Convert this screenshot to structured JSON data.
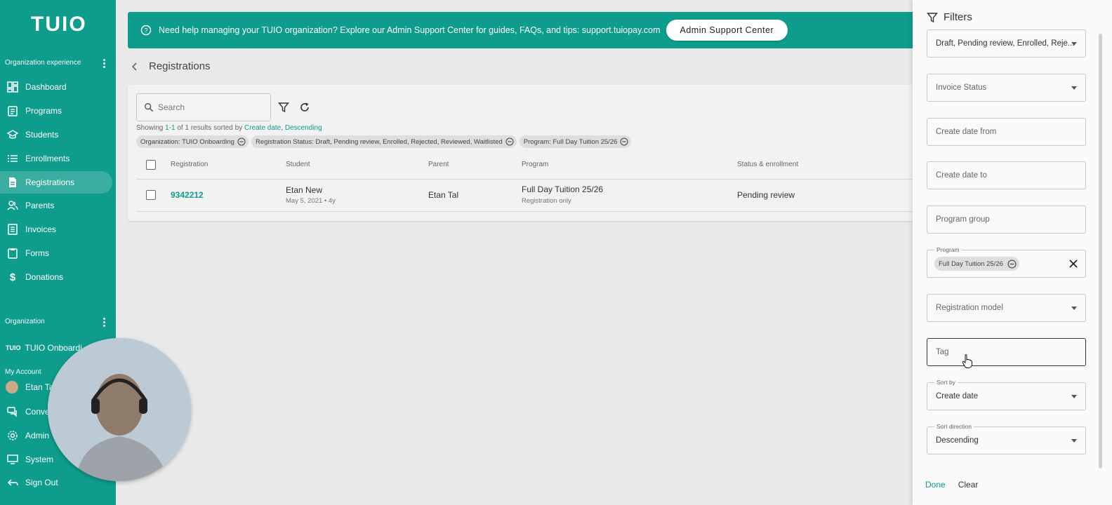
{
  "sidebar": {
    "logo": "TUIO",
    "section_org_experience": "Organization experience",
    "items": [
      {
        "label": "Dashboard"
      },
      {
        "label": "Programs"
      },
      {
        "label": "Students"
      },
      {
        "label": "Enrollments"
      },
      {
        "label": "Registrations"
      },
      {
        "label": "Parents"
      },
      {
        "label": "Invoices"
      },
      {
        "label": "Forms"
      },
      {
        "label": "Donations"
      }
    ],
    "section_organization": "Organization",
    "org_logo": "TUIO",
    "org_name": "TUIO Onboardi",
    "section_my_account": "My Account",
    "account_items": [
      {
        "label": "Etan Ta"
      },
      {
        "label": "Conve"
      },
      {
        "label": "Admin"
      },
      {
        "label": "System"
      },
      {
        "label": "Sign Out"
      }
    ]
  },
  "banner": {
    "text": "Need help managing your TUIO organization? Explore our Admin Support Center for guides, FAQs, and tips: support.tuiopay.com",
    "button": "Admin Support Center"
  },
  "page": {
    "title": "Registrations"
  },
  "toolbar": {
    "search_placeholder": "Search",
    "showing_prefix": "Showing",
    "showing_range": "1-1",
    "showing_mid": "of 1 results sorted by",
    "sort_field": "Create date",
    "sort_sep": ",",
    "sort_dir": "Descending"
  },
  "active_filters": [
    "Organization: TUIO Onboarding",
    "Registration Status: Draft, Pending review, Enrolled, Rejected, Reviewed, Waitlisted",
    "Program: Full Day Tuition 25/26"
  ],
  "table": {
    "columns": [
      "Registration",
      "Student",
      "Parent",
      "Program",
      "Status & enrollment"
    ],
    "rows": [
      {
        "registration": "9342212",
        "student": "Etan New",
        "student_sub": "May 5, 2021 • 4y",
        "parent": "Etan Tal",
        "program": "Full Day Tuition 25/26",
        "program_sub": "Registration only",
        "status": "Pending review"
      }
    ]
  },
  "filters": {
    "title": "Filters",
    "registration_status_value": "Draft, Pending review, Enrolled, Reje...",
    "invoice_status_placeholder": "Invoice Status",
    "create_date_from_placeholder": "Create date from",
    "create_date_to_placeholder": "Create date to",
    "program_group_placeholder": "Program group",
    "program_label": "Program",
    "program_chip": "Full Day Tuition 25/26",
    "registration_model_placeholder": "Registration model",
    "tag_placeholder": "Tag",
    "sort_by_label": "Sort by",
    "sort_by_value": "Create date",
    "sort_direction_label": "Sort direction",
    "sort_direction_value": "Descending",
    "done": "Done",
    "clear": "Clear"
  },
  "colors": {
    "brand": "#0e9c8c"
  }
}
